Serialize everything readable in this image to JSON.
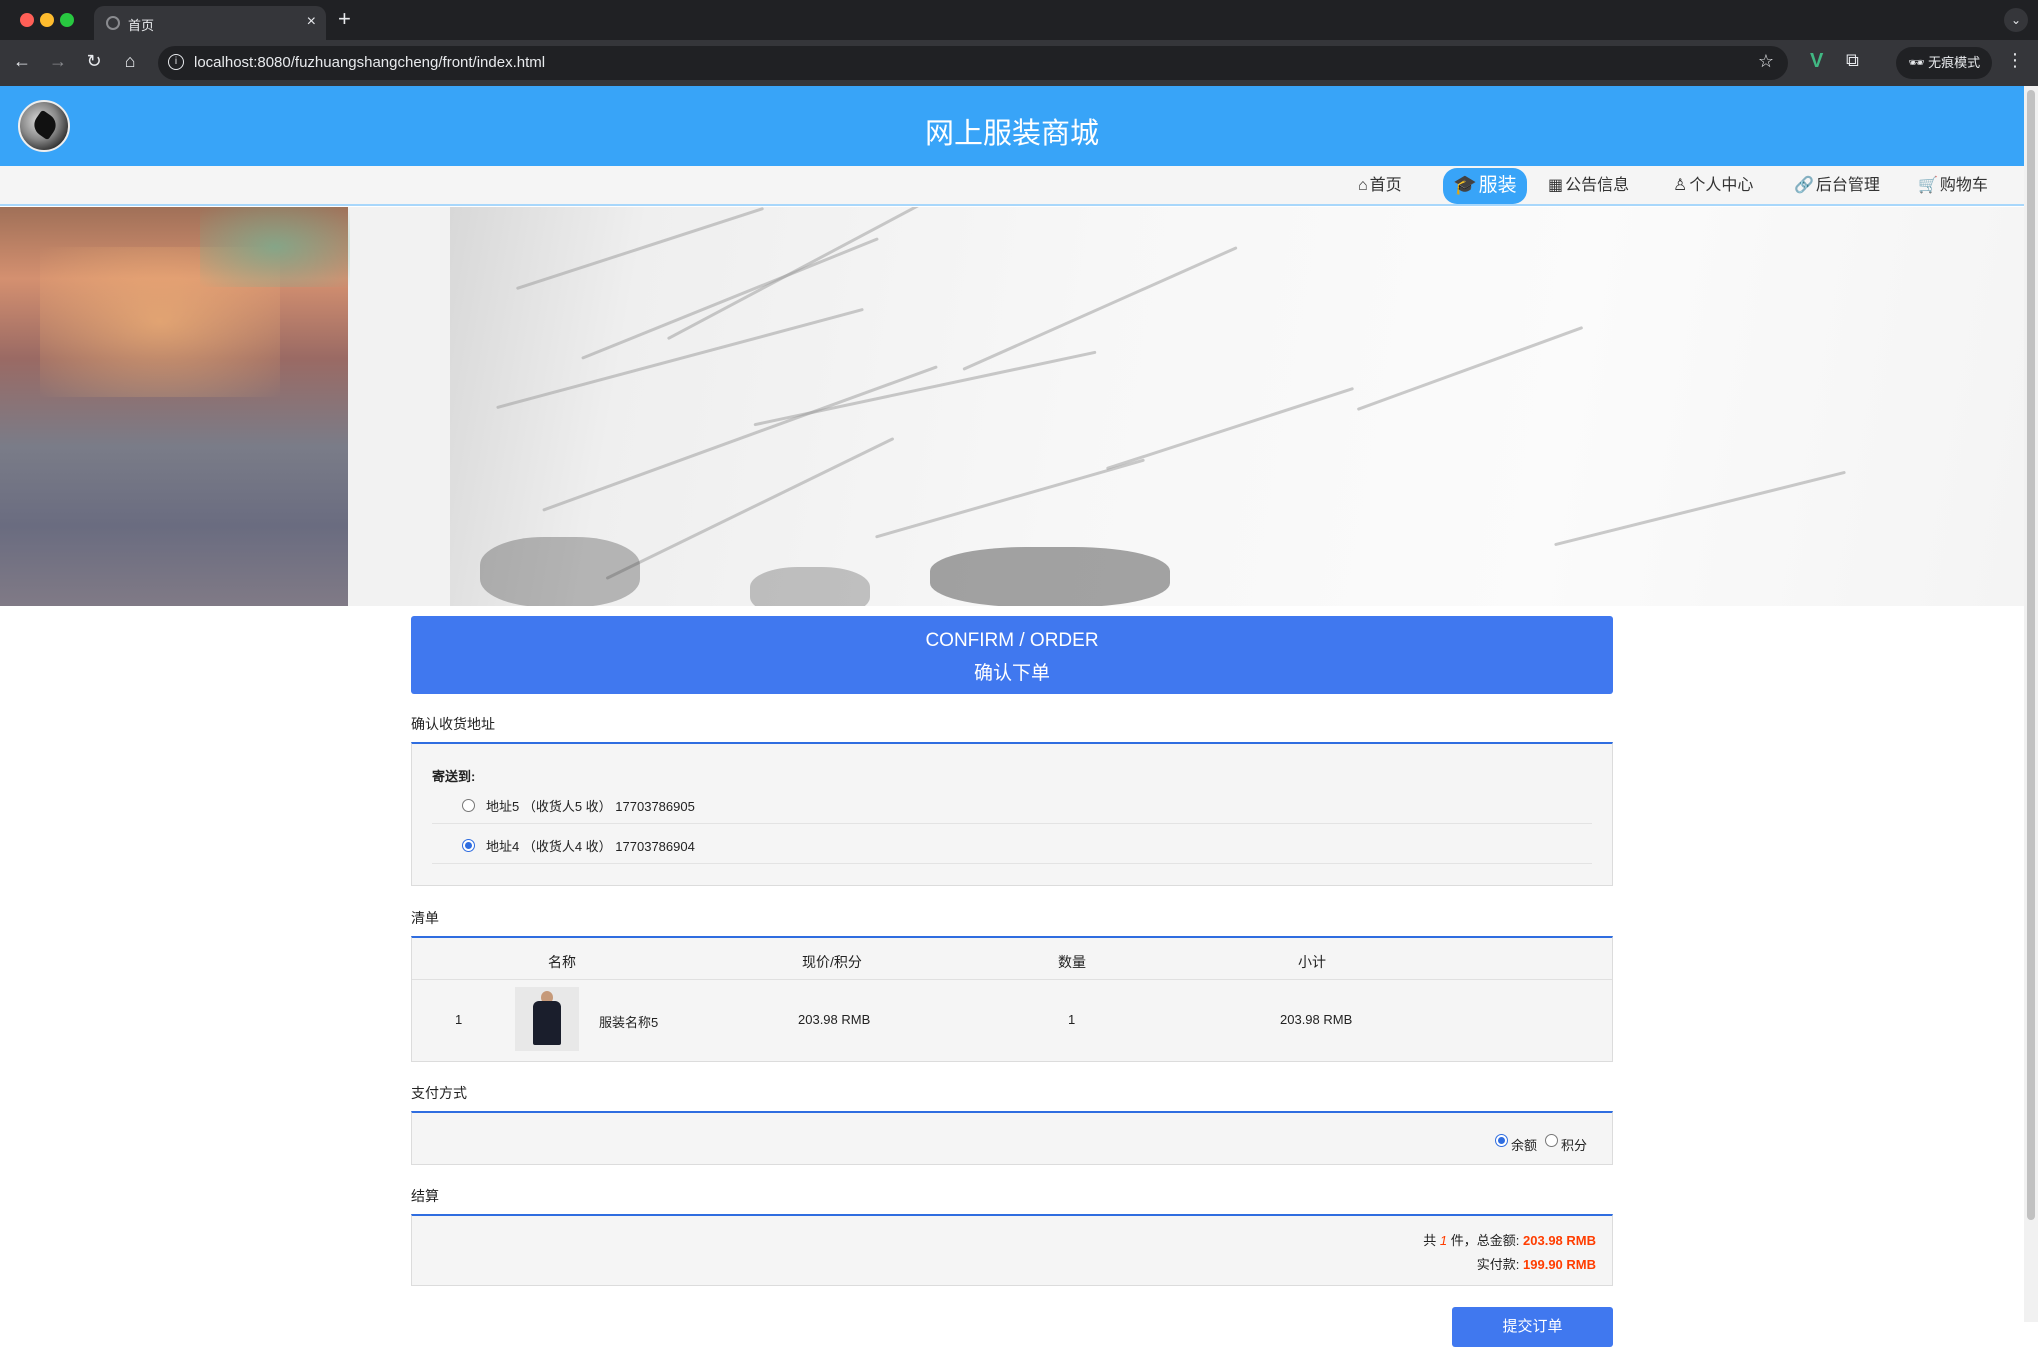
{
  "browser": {
    "tab_title": "首页",
    "tab_close": "×",
    "new_tab": "+",
    "url": "localhost:8080/fuzhuangshangcheng/front/index.html",
    "incognito_label": "无痕模式"
  },
  "site": {
    "title": "网上服装商城"
  },
  "nav": {
    "items": [
      {
        "icon": "⌂",
        "label": "首页"
      },
      {
        "icon": "🎓",
        "label": "服装"
      },
      {
        "icon": "▦",
        "label": "公告信息"
      },
      {
        "icon": "♙",
        "label": "个人中心"
      },
      {
        "icon": "🔗",
        "label": "后台管理"
      },
      {
        "icon": "🛒",
        "label": "购物车"
      }
    ],
    "active_index": 1
  },
  "order": {
    "header_en": "CONFIRM / ORDER",
    "header_cn": "确认下单",
    "address_section": "确认收货地址",
    "send_to": "寄送到:",
    "addresses": [
      {
        "text": "地址5 （收货人5 收） 17703786905",
        "selected": false
      },
      {
        "text": "地址4 （收货人4 收） 17703786904",
        "selected": true
      }
    ],
    "list_section": "清单",
    "columns": [
      "名称",
      "现价/积分",
      "数量",
      "小计"
    ],
    "items": [
      {
        "index": "1",
        "name": "服装名称5",
        "price": "203.98 RMB",
        "qty": "1",
        "subtotal": "203.98 RMB"
      }
    ],
    "payment_section": "支付方式",
    "payment_options": [
      {
        "label": "余额",
        "selected": true
      },
      {
        "label": "积分",
        "selected": false
      }
    ],
    "settle_section": "结算",
    "summary": {
      "prefix": "共",
      "count": "1",
      "count_suffix": "件，总金额:",
      "total": "203.98 RMB",
      "paid_label": "实付款:",
      "paid": "199.90 RMB"
    },
    "submit_label": "提交订单"
  }
}
